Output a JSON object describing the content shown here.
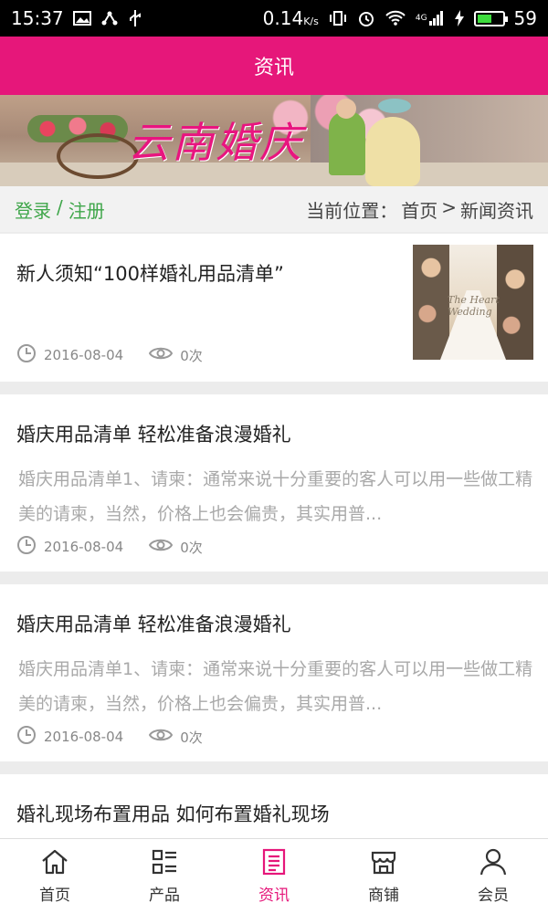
{
  "status_bar": {
    "time": "15:37",
    "speed": "0.14",
    "speed_unit": "K/s",
    "network": "4G",
    "battery_level": "59",
    "battery_color": "#3ddc3d"
  },
  "header": {
    "title": "资讯",
    "color": "#e6177a"
  },
  "banner": {
    "title": "云南婚庆"
  },
  "auth": {
    "login": "登录",
    "sep": "/",
    "register": "注册"
  },
  "breadcrumb": {
    "prefix": "当前位置：",
    "home": "首页",
    "arrow": ">",
    "current": "新闻资讯"
  },
  "articles": [
    {
      "title": "新人须知“100样婚礼用品清单”",
      "summary": "",
      "date": "2016-08-04",
      "views": "0次",
      "thumb_text": "The Heart\nWedding"
    },
    {
      "title": "婚庆用品清单 轻松准备浪漫婚礼",
      "summary": "婚庆用品清单1、请柬：通常来说十分重要的客人可以用一些做工精美的请柬，当然，价格上也会偏贵，其实用普...",
      "date": "2016-08-04",
      "views": "0次"
    },
    {
      "title": "婚庆用品清单 轻松准备浪漫婚礼",
      "summary": "婚庆用品清单1、请柬：通常来说十分重要的客人可以用一些做工精美的请柬，当然，价格上也会偏贵，其实用普...",
      "date": "2016-08-04",
      "views": "0次"
    },
    {
      "title": "婚礼现场布置用品 如何布置婚礼现场"
    }
  ],
  "nav": [
    {
      "label": "首页",
      "icon": "home-icon"
    },
    {
      "label": "产品",
      "icon": "list-icon"
    },
    {
      "label": "资讯",
      "icon": "news-icon",
      "active": true
    },
    {
      "label": "商铺",
      "icon": "shop-icon"
    },
    {
      "label": "会员",
      "icon": "user-icon"
    }
  ]
}
